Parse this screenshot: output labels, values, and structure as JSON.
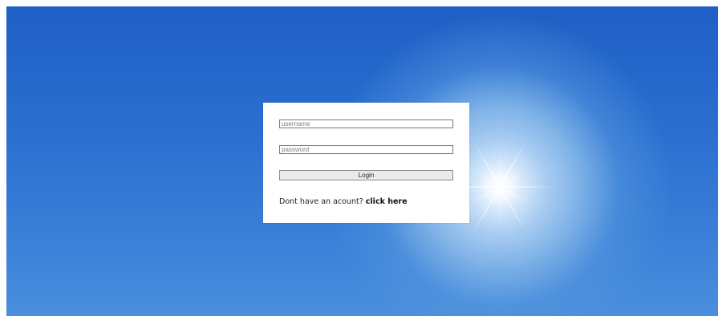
{
  "background": {
    "description_colors": {
      "sky_top": "#1f5fc5",
      "sky_bottom": "#4a8fdd",
      "sun": "#ffffff"
    }
  },
  "login": {
    "username_placeholder": "username",
    "password_placeholder": "password",
    "login_label": "Login",
    "signup_prompt": "Dont have an acount?",
    "signup_link": "click here"
  }
}
